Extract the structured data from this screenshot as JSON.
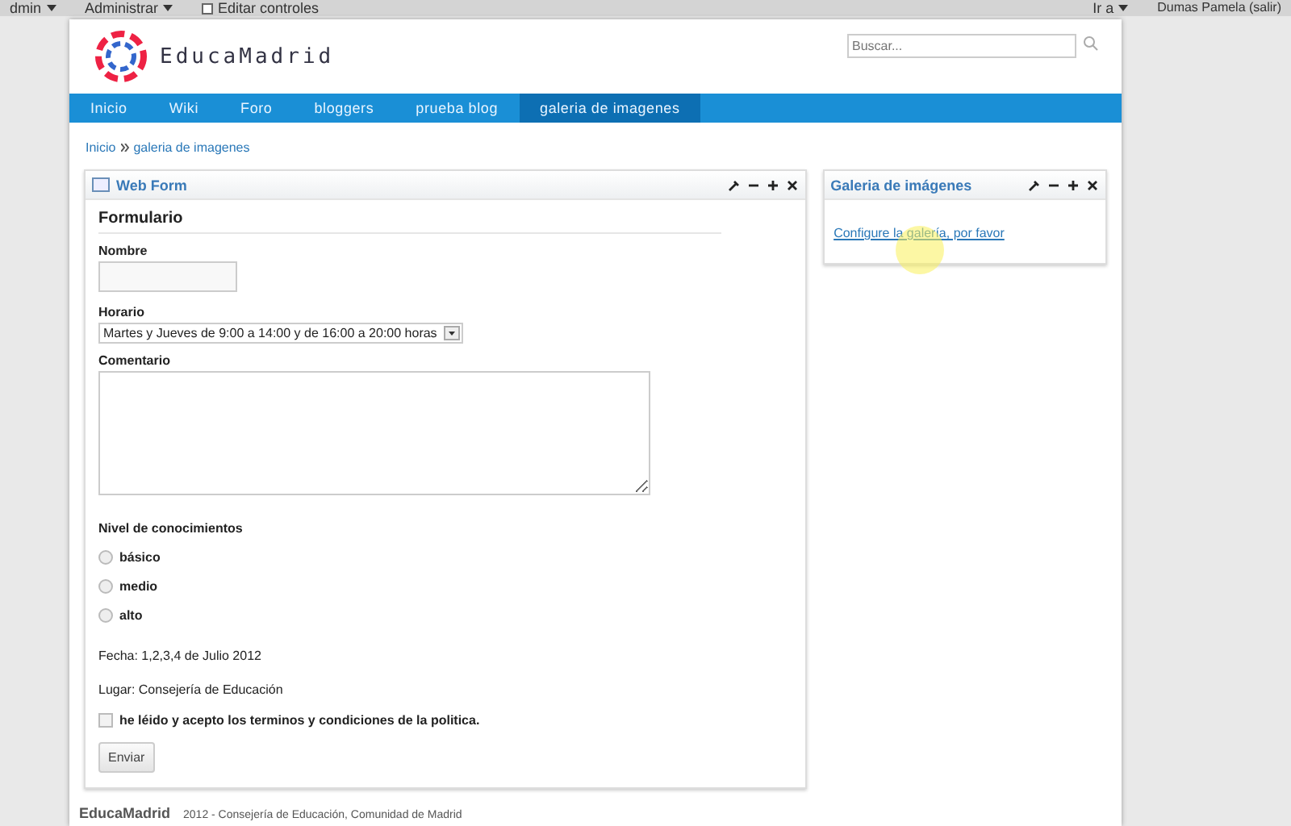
{
  "top_bar": {
    "items": [
      {
        "label": "dmin",
        "kind": "menu"
      },
      {
        "label": "Administrar",
        "kind": "menu"
      },
      {
        "label": "Editar controles",
        "kind": "check"
      }
    ],
    "goto": "Ir a",
    "user": "Dumas Pamela (salir)"
  },
  "header": {
    "logo_text": "EducaMadrid",
    "search": {
      "placeholder": "Buscar..."
    }
  },
  "nav": [
    {
      "label": "Inicio",
      "selected": false
    },
    {
      "label": "Wiki",
      "selected": false
    },
    {
      "label": "Foro",
      "selected": false
    },
    {
      "label": "bloggers",
      "selected": false
    },
    {
      "label": "prueba blog",
      "selected": false
    },
    {
      "label": "galeria de imagenes",
      "selected": true
    }
  ],
  "breadcrumb": [
    "Inicio",
    "galeria de imagenes"
  ],
  "web_form": {
    "title": "Web Form",
    "heading": "Formulario",
    "name_label": "Nombre",
    "schedule_label": "Horario",
    "schedule_value": "Martes y Jueves de 9:00 a 14:00 y de 16:00 a 20:00 horas",
    "comment_label": "Comentario",
    "level_label": "Nivel de conocimientos",
    "levels": [
      {
        "label": "básico",
        "selected": false
      },
      {
        "label": "medio",
        "selected": false
      },
      {
        "label": "alto",
        "selected": false
      }
    ],
    "date": "Fecha: 1,2,3,4 de Julio 2012",
    "place": "Lugar: Consejería de Educación",
    "terms": {
      "label": "he léido y acepto los terminos y condiciones de la politica.",
      "checked": false
    },
    "submit": "Enviar"
  },
  "gallery": {
    "title": "Galeria de imágenes",
    "link": "Configure la galería, por favor"
  },
  "footer": {
    "brand": "EducaMadrid",
    "text": "2012 - Consejería de Educación, Comunidad de Madrid"
  }
}
